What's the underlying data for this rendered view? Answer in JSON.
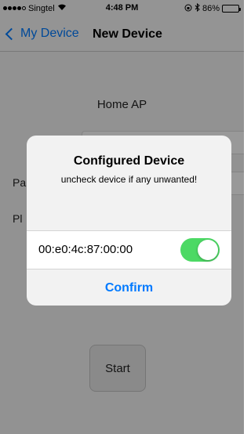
{
  "status_bar": {
    "carrier": "Singtel",
    "time": "4:48 PM",
    "battery_percent": "86%",
    "battery_level": 0.86,
    "signal_icon": "signal-dots-icon",
    "wifi_icon": "wifi-icon",
    "bluetooth_icon": "bluetooth-icon",
    "lock_icon": "orientation-lock-icon"
  },
  "nav": {
    "back_label": "My Device",
    "title": "New Device"
  },
  "background": {
    "ap_label": "Home AP",
    "password_label_partial": "Pa",
    "pl_label_partial": "Pl",
    "start_label": "Start"
  },
  "alert": {
    "title": "Configured Device",
    "message": "uncheck device if any unwanted!",
    "devices": [
      {
        "mac": "00:e0:4c:87:00:00",
        "checked": true
      }
    ],
    "confirm_label": "Confirm"
  },
  "colors": {
    "accent": "#007aff",
    "toggle_on": "#4cd964"
  }
}
